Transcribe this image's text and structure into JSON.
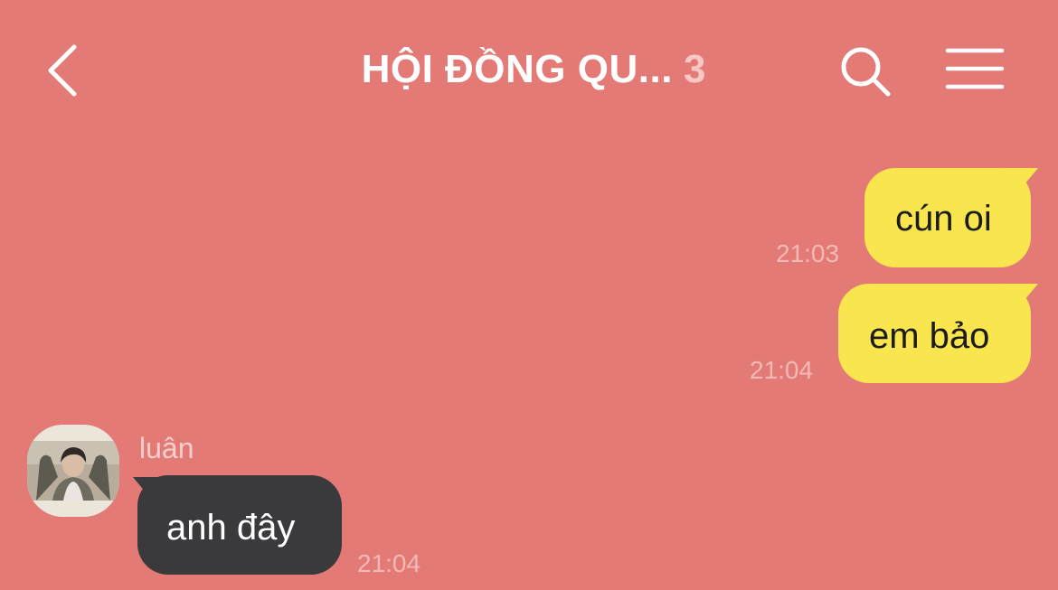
{
  "header": {
    "back_icon": "chevron-left-icon",
    "title": "HỘI ĐỒNG QU...",
    "member_count": "3",
    "search_icon": "search-icon",
    "menu_icon": "hamburger-menu-icon"
  },
  "messages": [
    {
      "direction": "outgoing",
      "text": "cún oi",
      "time": "21:03"
    },
    {
      "direction": "outgoing",
      "text": "em bảo",
      "time": "21:04"
    },
    {
      "direction": "incoming",
      "sender": "luân",
      "text": "anh đây",
      "time": "21:04"
    }
  ],
  "colors": {
    "background": "#e37a75",
    "outgoing_bubble": "#f9e54d",
    "incoming_bubble": "#3a3a3c",
    "timestamp": "#f4b9b5"
  }
}
